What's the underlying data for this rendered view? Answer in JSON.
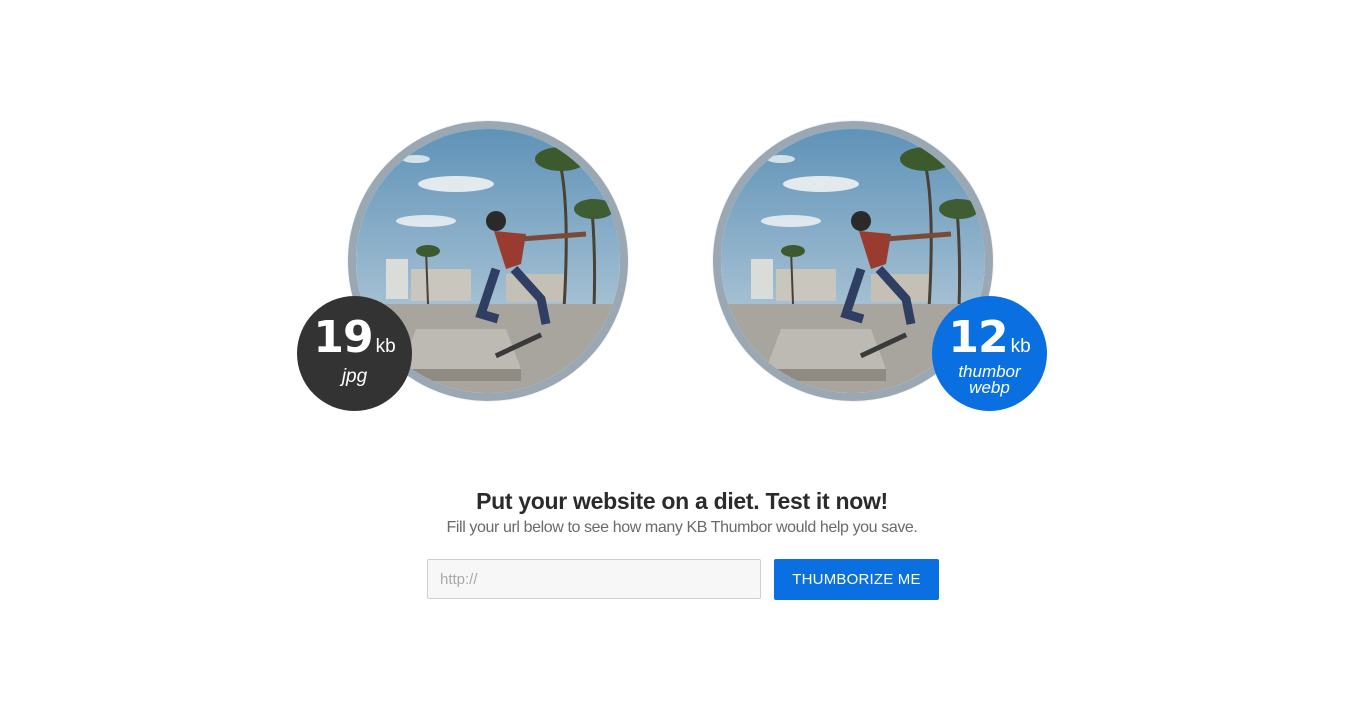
{
  "comparison": {
    "original": {
      "size": "19",
      "unit": "kb",
      "format_lines": [
        "jpg"
      ],
      "badge_color": "#333333"
    },
    "optimized": {
      "size": "12",
      "unit": "kb",
      "format_lines": [
        "thumbor",
        "webp"
      ],
      "badge_color": "#0a6fe0"
    },
    "photo_ring_color": "#9aa8b3"
  },
  "cta": {
    "headline": "Put your website on a diet. Test it now!",
    "subline": "Fill your url below to see how many KB Thumbor would help you save.",
    "input_placeholder": "http://",
    "input_value": "",
    "button_label": "THUMBORIZE ME",
    "accent_color": "#0a6fe0"
  }
}
